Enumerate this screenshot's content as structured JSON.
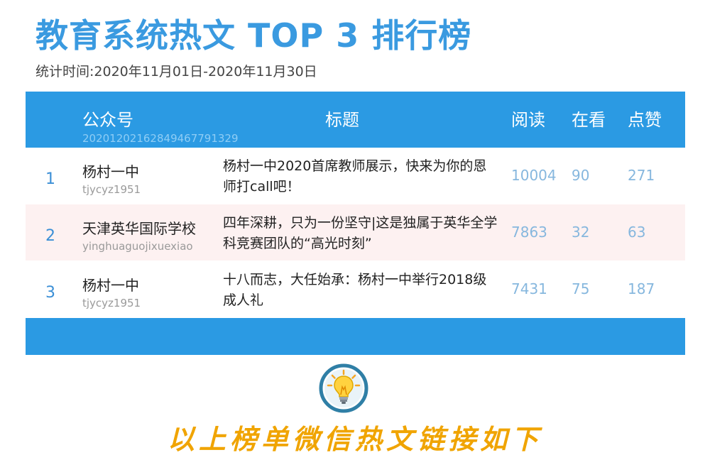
{
  "header": {
    "title": "教育系统热文 TOP 3 排行榜",
    "period": "统计时间:2020年11月01日-2020年11月30日"
  },
  "table": {
    "columns": {
      "account": "公众号",
      "title": "标题",
      "reads": "阅读",
      "watching": "在看",
      "likes": "点赞"
    },
    "column_sub": "20201202162849467791329",
    "rows": [
      {
        "rank": "1",
        "account_name": "杨村一中",
        "account_id": "tjycyz1951",
        "title": "杨村一中2020首席教师展示，快来为你的恩师打call吧！",
        "reads": "10004",
        "watching": "90",
        "likes": "271"
      },
      {
        "rank": "2",
        "account_name": "天津英华国际学校",
        "account_id": "yinghuaguojixuexiao",
        "title": "四年深耕，只为一份坚守|这是独属于英华全学科竞赛团队的“高光时刻”",
        "reads": "7863",
        "watching": "32",
        "likes": "63"
      },
      {
        "rank": "3",
        "account_name": "杨村一中",
        "account_id": "tjycyz1951",
        "title": "十八而志，大任始承：杨村一中举行2018级成人礼",
        "reads": "7431",
        "watching": "75",
        "likes": "187"
      }
    ]
  },
  "footer": {
    "icon": "lightbulb-icon",
    "text": "以上榜单微信热文链接如下"
  },
  "colors": {
    "accent": "#2b9ae3",
    "title": "#3a9ae0",
    "alt_row": "#fdf1f1",
    "numbers": "#86b7de",
    "bottom_text": "#f0a400",
    "bulb_ring": "#2f7fa6"
  }
}
